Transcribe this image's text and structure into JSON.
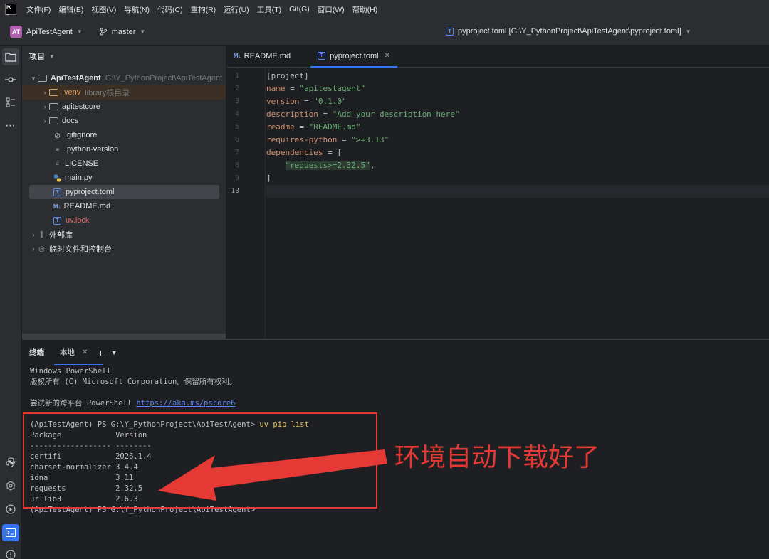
{
  "menubar": {
    "items": [
      "文件(F)",
      "编辑(E)",
      "视图(V)",
      "导航(N)",
      "代码(C)",
      "重构(R)",
      "运行(U)",
      "工具(T)",
      "Git(G)",
      "窗口(W)",
      "帮助(H)"
    ]
  },
  "titlebar": {
    "badge": "AT",
    "project": "ApiTestAgent",
    "branch": "master",
    "file_path": "pyproject.toml [G:\\Y_PythonProject\\ApiTestAgent\\pyproject.toml]"
  },
  "project_panel": {
    "header": "项目",
    "root_name": "ApiTestAgent",
    "root_path": "G:\\Y_PythonProject\\ApiTestAgent",
    "items": [
      {
        "name": ".venv",
        "hint": "library根目录"
      },
      {
        "name": "apitestcore"
      },
      {
        "name": "docs"
      },
      {
        "name": ".gitignore"
      },
      {
        "name": ".python-version"
      },
      {
        "name": "LICENSE"
      },
      {
        "name": "main.py"
      },
      {
        "name": "pyproject.toml"
      },
      {
        "name": "README.md"
      },
      {
        "name": "uv.lock"
      }
    ],
    "external_libs": "外部库",
    "scratches": "临时文件和控制台"
  },
  "editor": {
    "tabs": [
      {
        "icon": "M↓",
        "label": "README.md"
      },
      {
        "icon": "T",
        "label": "pyproject.toml"
      }
    ],
    "line_numbers": [
      "1",
      "2",
      "3",
      "4",
      "5",
      "6",
      "7",
      "8",
      "9",
      "10"
    ],
    "code": {
      "l1": "[project]",
      "l2_key": "name",
      "l2_val": "\"apitestagent\"",
      "l3_key": "version",
      "l3_val": "\"0.1.0\"",
      "l4_key": "description",
      "l4_val": "\"Add your description here\"",
      "l5_key": "readme",
      "l5_val": "\"README.md\"",
      "l6_key": "requires-python",
      "l6_val": "\">=3.13\"",
      "l7_key": "dependencies",
      "l7_val": "[",
      "l8_val": "\"requests>=2.32.5\"",
      "l9": "]",
      "eq": " = ",
      "comma": ","
    }
  },
  "terminal": {
    "title": "终端",
    "tab": "本地",
    "lines": {
      "l1": "Windows PowerShell",
      "l2": "版权所有 (C) Microsoft Corporation。保留所有权利。",
      "l3_pre": "尝试新的跨平台 PowerShell ",
      "l3_link": "https://aka.ms/pscore6",
      "prompt": "(ApiTestAgent) PS G:\\Y_PythonProject\\ApiTestAgent> ",
      "cmd": "uv pip list",
      "header": "Package            Version",
      "sep": "------------------ --------",
      "p1": "certifi            2026.1.4",
      "p2": "charset-normalizer 3.4.4",
      "p3": "idna               3.11",
      "p4": "requests           2.32.5",
      "p5": "urllib3            2.6.3",
      "last": "(ApiTestAgent) PS G:\\Y_PythonProject\\ApiTestAgent>"
    }
  },
  "annotation": {
    "text": "环境自动下载好了",
    "color": "#e53935"
  }
}
